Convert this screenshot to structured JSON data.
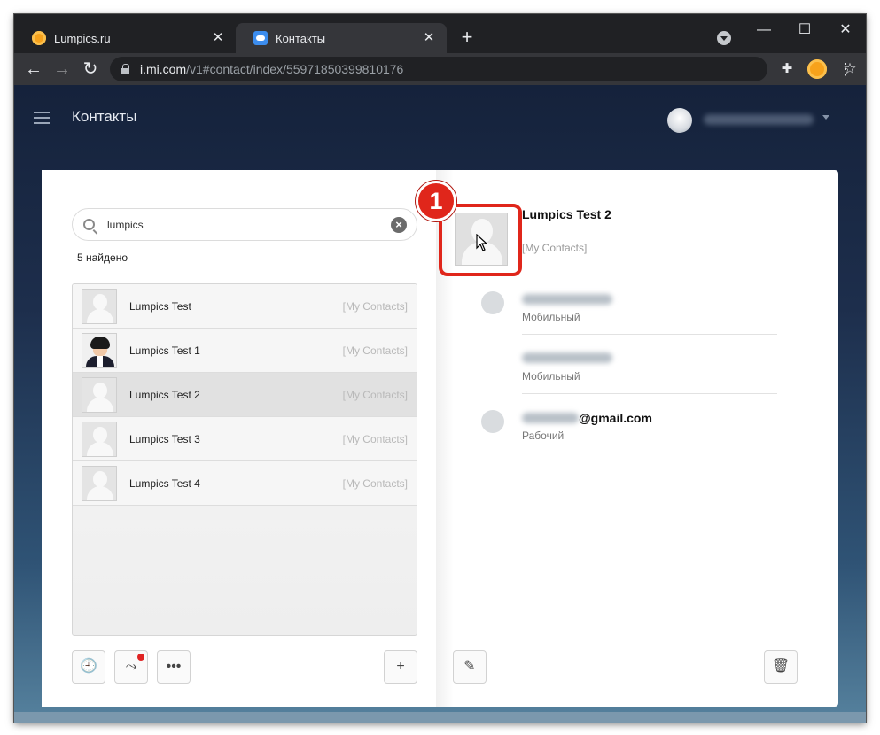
{
  "browser": {
    "tabs": [
      {
        "title": "Lumpics.ru",
        "active": false
      },
      {
        "title": "Контакты",
        "active": true
      }
    ],
    "url_host": "i.mi.com",
    "url_path": "/v1#contact/index/55971850399810176"
  },
  "app": {
    "title": "Контакты"
  },
  "search": {
    "value": "lumpics",
    "found_text": "5 найдено"
  },
  "contacts": [
    {
      "name": "Lumpics Test",
      "group": "[My Contacts]",
      "avatar": "placeholder"
    },
    {
      "name": "Lumpics Test 1",
      "group": "[My Contacts]",
      "avatar": "photo"
    },
    {
      "name": "Lumpics Test 2",
      "group": "[My Contacts]",
      "avatar": "placeholder",
      "selected": true
    },
    {
      "name": "Lumpics Test 3",
      "group": "[My Contacts]",
      "avatar": "placeholder"
    },
    {
      "name": "Lumpics Test 4",
      "group": "[My Contacts]",
      "avatar": "placeholder"
    }
  ],
  "detail": {
    "name": "Lumpics Test 2",
    "group": "[My Contacts]",
    "phone1_label": "Мобильный",
    "phone2_label": "Мобильный",
    "email_domain": "@gmail.com",
    "email_label": "Рабочий"
  },
  "annotation": {
    "step": "1"
  },
  "colors": {
    "accent_red": "#e0261b",
    "page_bg_top": "#15223b",
    "page_bg_bottom": "#56829e"
  }
}
